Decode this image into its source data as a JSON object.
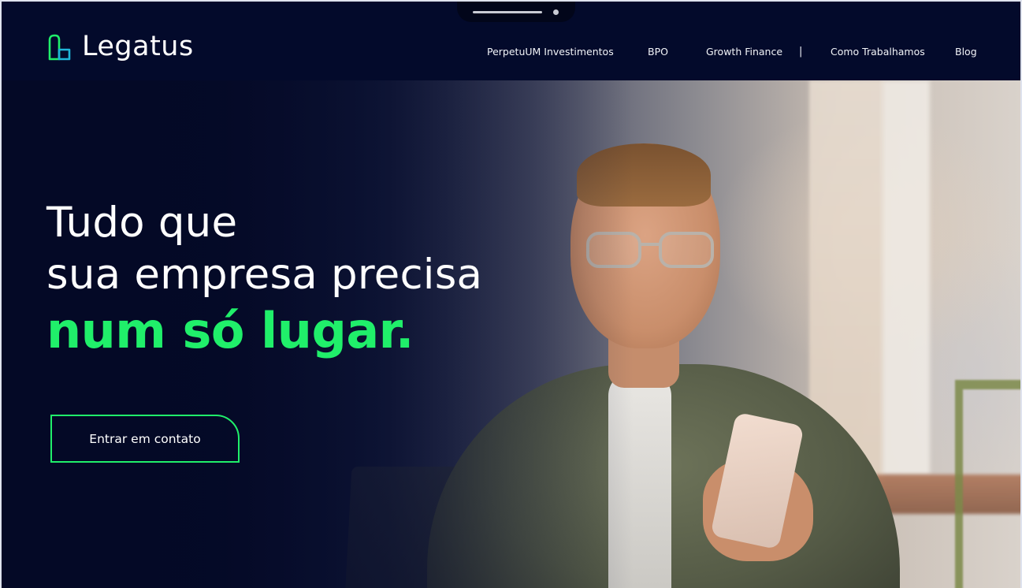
{
  "brand": {
    "name": "Legatus",
    "logo_icon": "legatus-logo-icon",
    "accent_color": "#20ef6a",
    "navy_color": "#030a2b"
  },
  "nav": {
    "items": [
      {
        "label": "PerpetuUM Investimentos"
      },
      {
        "label": "BPO"
      },
      {
        "label": "Growth Finance"
      },
      {
        "label": "Como Trabalhamos"
      },
      {
        "label": "Blog"
      }
    ],
    "separator": "|"
  },
  "hero": {
    "line1": "Tudo que",
    "line2": "sua empresa precisa",
    "line3": "num só lugar.",
    "cta_label": "Entrar em contato",
    "image": "smiling-man-with-phone-photo"
  }
}
